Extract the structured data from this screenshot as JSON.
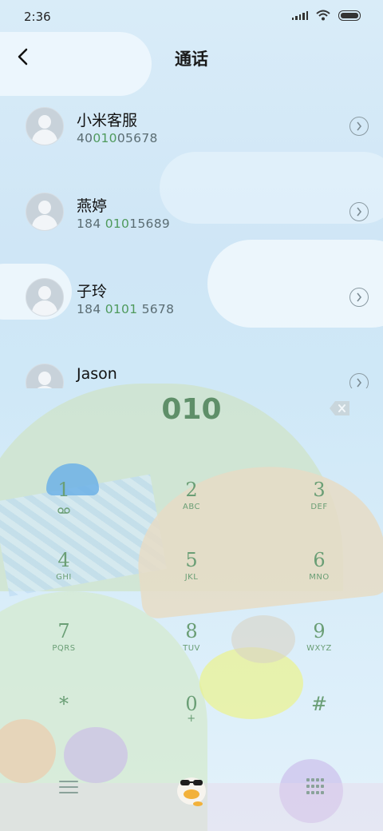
{
  "status": {
    "time": "2:36"
  },
  "header": {
    "title": "通话"
  },
  "contacts": [
    {
      "name": "小米客服",
      "number_pre": "40",
      "number_hl": "010",
      "number_post": "05678"
    },
    {
      "name": "燕婷",
      "number_pre": "184 ",
      "number_hl": "010",
      "number_post": "15689"
    },
    {
      "name": "子玲",
      "number_pre": "184 ",
      "number_hl": "0101",
      "number_post": " 5678"
    },
    {
      "name": "Jason",
      "number_pre": "",
      "number_hl": "",
      "number_post": ""
    }
  ],
  "dialer": {
    "digits": "010"
  },
  "keypad": [
    {
      "digit": "1",
      "letters": ""
    },
    {
      "digit": "2",
      "letters": "ABC"
    },
    {
      "digit": "3",
      "letters": "DEF"
    },
    {
      "digit": "4",
      "letters": "GHI"
    },
    {
      "digit": "5",
      "letters": "JKL"
    },
    {
      "digit": "6",
      "letters": "MNO"
    },
    {
      "digit": "7",
      "letters": "PQRS"
    },
    {
      "digit": "8",
      "letters": "TUV"
    },
    {
      "digit": "9",
      "letters": "WXYZ"
    },
    {
      "digit": "*",
      "letters": ""
    },
    {
      "digit": "0",
      "letters": "+"
    },
    {
      "digit": "#",
      "letters": ""
    }
  ],
  "colors": {
    "accent": "#4f9a5c",
    "keypad_text": "#6a9e75"
  },
  "icons": [
    "back-arrow-icon",
    "chevron-right-icon",
    "backspace-icon",
    "voicemail-icon",
    "menu-icon",
    "dialpad-grid-icon",
    "call-button-icon"
  ]
}
